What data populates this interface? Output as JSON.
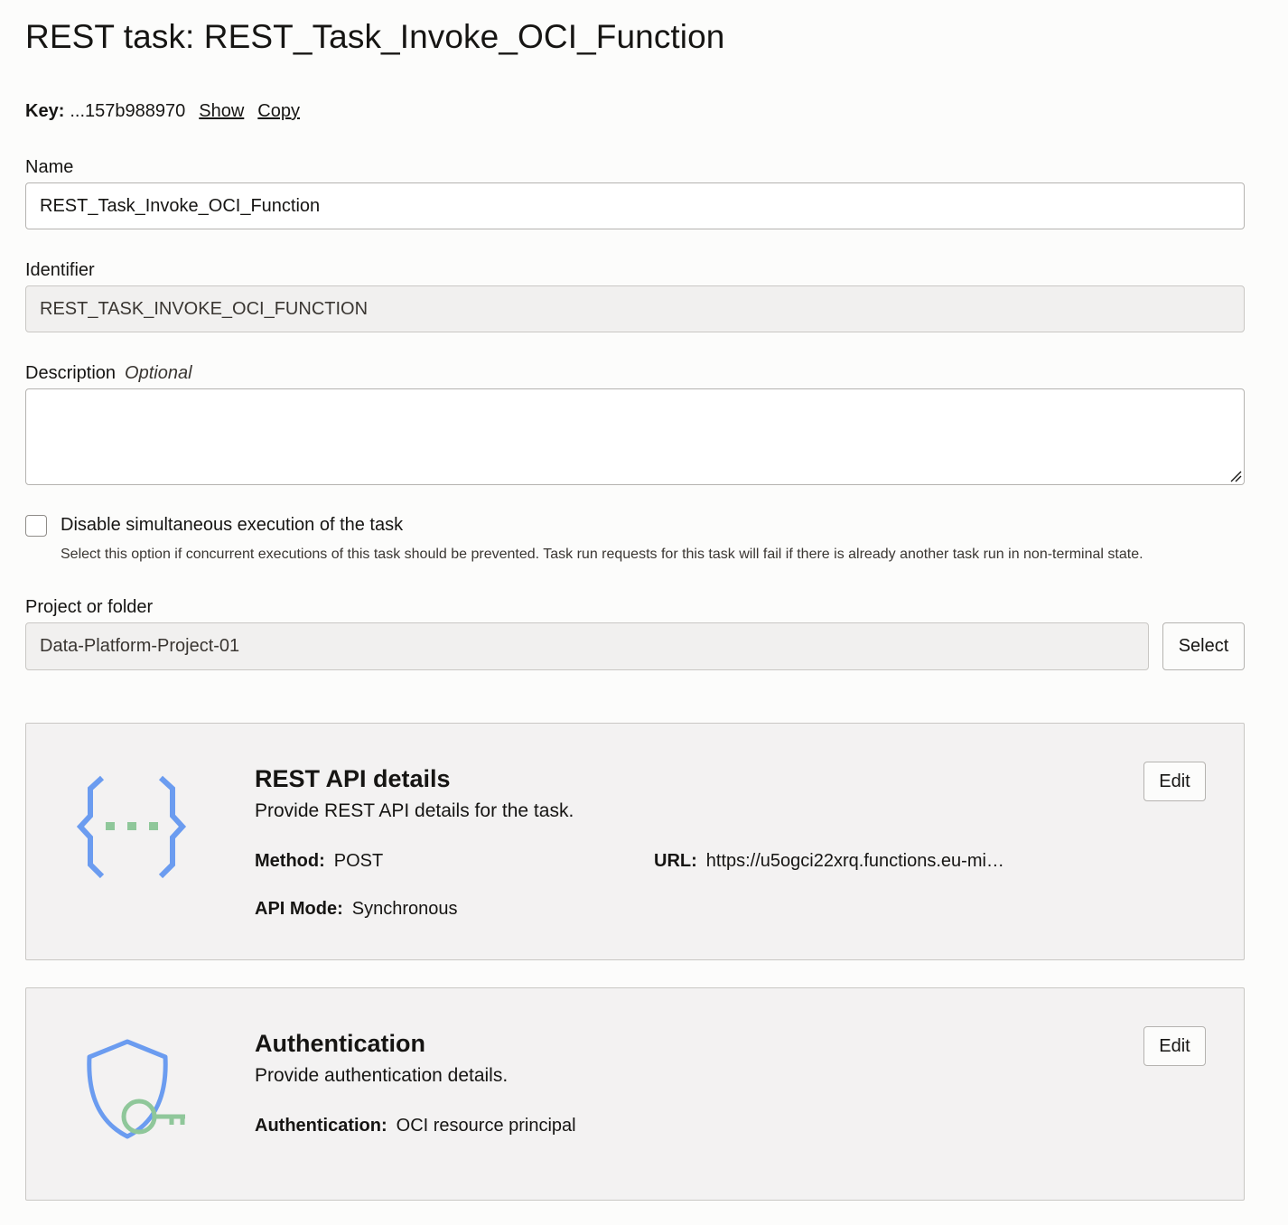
{
  "page": {
    "title": "REST task: REST_Task_Invoke_OCI_Function"
  },
  "key": {
    "label": "Key:",
    "value": "...157b988970",
    "show_link": "Show",
    "copy_link": "Copy"
  },
  "form": {
    "name": {
      "label": "Name",
      "value": "REST_Task_Invoke_OCI_Function"
    },
    "identifier": {
      "label": "Identifier",
      "value": "REST_TASK_INVOKE_OCI_FUNCTION"
    },
    "description": {
      "label": "Description",
      "optional": "Optional",
      "value": ""
    },
    "disable_concurrent": {
      "label": "Disable simultaneous execution of the task",
      "help": "Select this option if concurrent executions of this task should be prevented. Task run requests for this task will fail if there is already another task run in non-terminal state.",
      "checked": false
    },
    "project": {
      "label": "Project or folder",
      "value": "Data-Platform-Project-01",
      "select_label": "Select"
    }
  },
  "rest_api_card": {
    "icon": "curly-braces-icon",
    "title": "REST API details",
    "subtitle": "Provide REST API details for the task.",
    "edit_label": "Edit",
    "method_label": "Method:",
    "method_value": "POST",
    "url_label": "URL:",
    "url_value": "https://u5ogci22xrq.functions.eu-mi…",
    "api_mode_label": "API Mode:",
    "api_mode_value": "Synchronous"
  },
  "auth_card": {
    "icon": "shield-key-icon",
    "title": "Authentication",
    "subtitle": "Provide authentication details.",
    "edit_label": "Edit",
    "auth_label": "Authentication:",
    "auth_value": "OCI resource principal"
  },
  "colors": {
    "icon_blue": "#6b9cf0",
    "icon_green": "#8fc79a",
    "card_bg": "#f3f2f2"
  }
}
